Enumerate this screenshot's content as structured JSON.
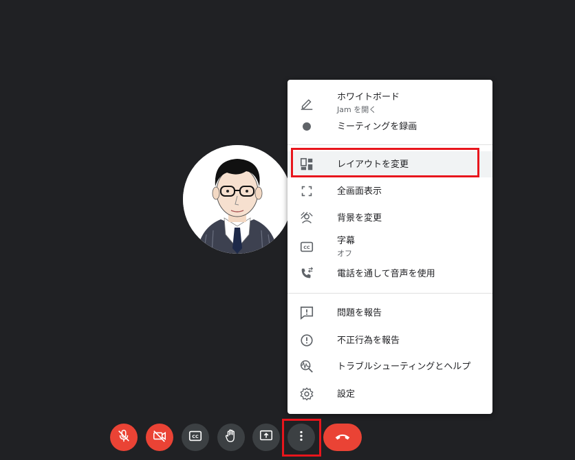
{
  "participant": {
    "avatar_icon": "person-portrait"
  },
  "menu": {
    "items": [
      {
        "label": "ホワイトボード",
        "sub": "Jam を開く",
        "icon": "pencil-icon"
      },
      {
        "label": "ミーティングを録画",
        "icon": "record-icon"
      },
      {
        "label": "レイアウトを変更",
        "icon": "layout-icon",
        "highlighted": true
      },
      {
        "label": "全画面表示",
        "icon": "fullscreen-icon"
      },
      {
        "label": "背景を変更",
        "icon": "background-icon"
      },
      {
        "label": "字幕",
        "sub": "オフ",
        "icon": "captions-icon"
      },
      {
        "label": "電話を通して音声を使用",
        "icon": "phone-audio-icon"
      },
      {
        "label": "問題を報告",
        "icon": "feedback-icon"
      },
      {
        "label": "不正行為を報告",
        "icon": "report-abuse-icon"
      },
      {
        "label": "トラブルシューティングとヘルプ",
        "icon": "troubleshoot-icon"
      },
      {
        "label": "設定",
        "icon": "settings-icon"
      }
    ]
  },
  "controls": [
    {
      "icon": "mic-off-icon",
      "color": "#ea4335"
    },
    {
      "icon": "camera-off-icon",
      "color": "#ea4335"
    },
    {
      "icon": "captions-icon",
      "color": "#3c4043"
    },
    {
      "icon": "raise-hand-icon",
      "color": "#3c4043"
    },
    {
      "icon": "present-icon",
      "color": "#3c4043"
    },
    {
      "icon": "more-options-icon",
      "color": "#3c4043"
    },
    {
      "icon": "hang-up-icon",
      "color": "#ea4335"
    }
  ],
  "colors": {
    "background": "#202124",
    "highlight_box": "#e8151c",
    "danger": "#ea4335"
  }
}
